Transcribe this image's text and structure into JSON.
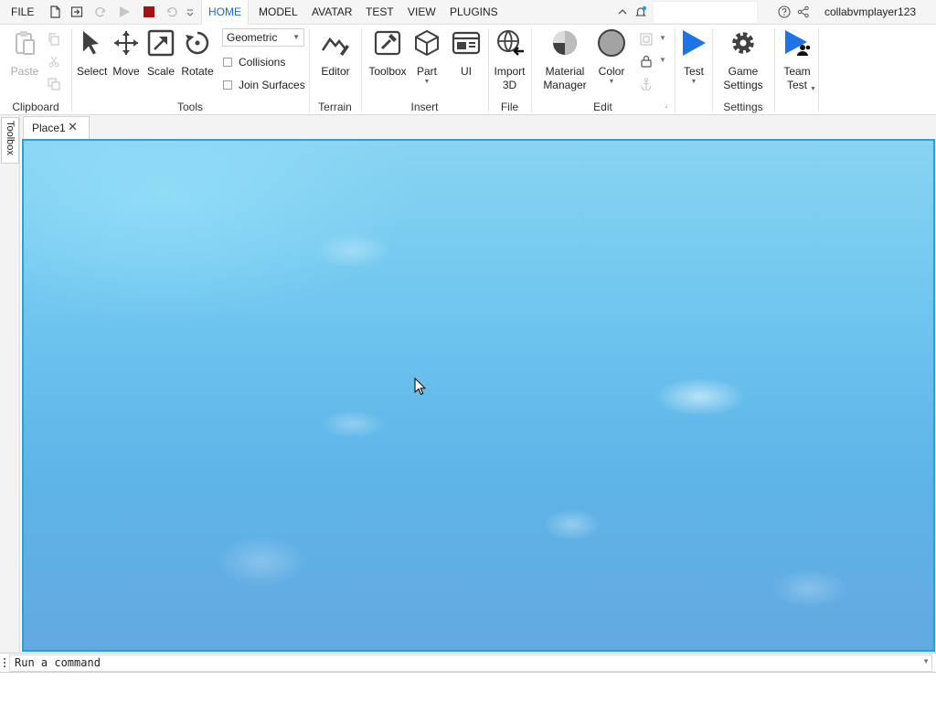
{
  "menubar": {
    "file_label": "FILE",
    "tabs": [
      {
        "label": "HOME",
        "active": true
      },
      {
        "label": "MODEL",
        "active": false
      },
      {
        "label": "AVATAR",
        "active": false
      },
      {
        "label": "TEST",
        "active": false
      },
      {
        "label": "VIEW",
        "active": false
      },
      {
        "label": "PLUGINS",
        "active": false
      }
    ],
    "username": "collabvmplayer123"
  },
  "ribbon": {
    "clipboard": {
      "label": "Clipboard",
      "paste": "Paste"
    },
    "tools": {
      "label": "Tools",
      "select": "Select",
      "move": "Move",
      "scale": "Scale",
      "rotate": "Rotate",
      "snap_mode": "Geometric",
      "collisions": "Collisions",
      "join_surfaces": "Join Surfaces"
    },
    "terrain": {
      "label": "Terrain",
      "editor": "Editor"
    },
    "insert": {
      "label": "Insert",
      "toolbox": "Toolbox",
      "part": "Part",
      "ui": "UI"
    },
    "file": {
      "label": "File",
      "import3d_line1": "Import",
      "import3d_line2": "3D"
    },
    "edit": {
      "label": "Edit",
      "material_line1": "Material",
      "material_line2": "Manager",
      "color": "Color"
    },
    "test": {
      "label": "Test"
    },
    "settings": {
      "label": "Settings",
      "game_settings_line1": "Game",
      "game_settings_line2": "Settings"
    },
    "teamtest": {
      "line1": "Team",
      "line2": "Test"
    }
  },
  "dock": {
    "toolbox_tab": "Toolbox"
  },
  "doc_tabs": [
    {
      "label": "Place1"
    }
  ],
  "command_bar": {
    "placeholder": "Run a command"
  },
  "colors": {
    "accent": "#1b6ad6",
    "viewport_border": "#2aa0d8",
    "stop_red": "#a21414",
    "test_blue": "#1e73e8"
  }
}
